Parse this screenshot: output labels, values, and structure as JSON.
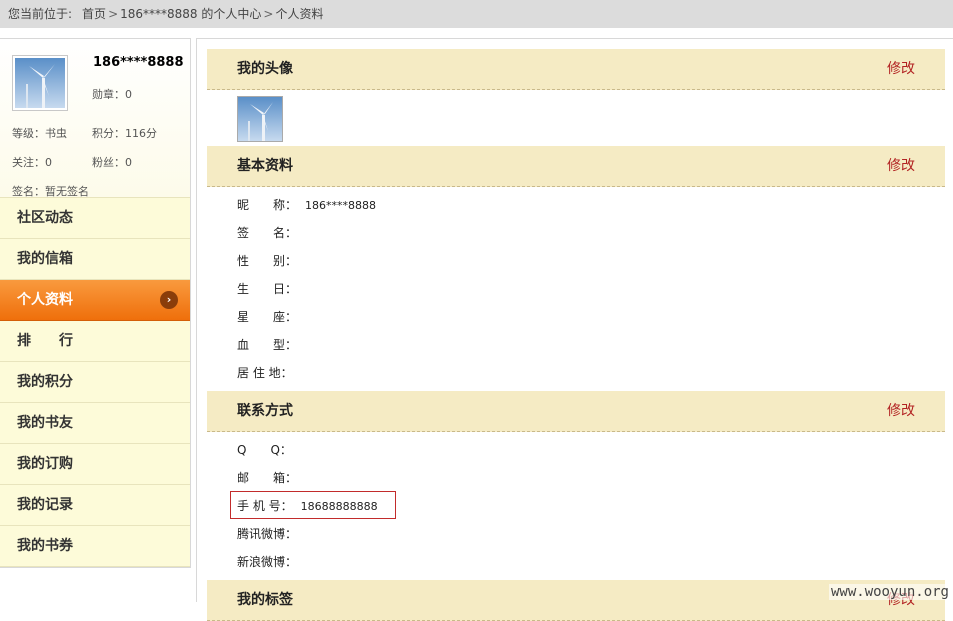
{
  "breadcrumb": {
    "prefix": "您当前位于:",
    "items": [
      "首页",
      "186****8888 的个人中心",
      "个人资料"
    ],
    "sep": ">"
  },
  "profile": {
    "name": "186****8888",
    "medal": "勋章：0",
    "stats": [
      "等级：书虫",
      "积分：116分",
      "关注：0",
      "粉丝：0",
      "签名：暂无签名"
    ]
  },
  "nav": {
    "items": [
      "社区动态",
      "我的信箱",
      "个人资料",
      "排　　行",
      "我的积分",
      "我的书友",
      "我的订购",
      "我的记录",
      "我的书券"
    ],
    "active_arrow": "›"
  },
  "sections": {
    "avatar": {
      "title": "我的头像",
      "edit": "修改"
    },
    "basic": {
      "title": "基本资料",
      "edit": "修改",
      "fields": [
        {
          "label": "昵　　称：",
          "value": "186****8888"
        },
        {
          "label": "签　　名：",
          "value": ""
        },
        {
          "label": "性　　别：",
          "value": ""
        },
        {
          "label": "生　　日：",
          "value": ""
        },
        {
          "label": "星　　座：",
          "value": ""
        },
        {
          "label": "血　　型：",
          "value": ""
        },
        {
          "label": "居 住 地：",
          "value": ""
        }
      ]
    },
    "contact": {
      "title": "联系方式",
      "edit": "修改",
      "fields": [
        {
          "label": "Q　　Q：",
          "value": ""
        },
        {
          "label": "邮　　箱：",
          "value": ""
        },
        {
          "label": "手 机 号：",
          "value": "18688888888"
        },
        {
          "label": "腾讯微博：",
          "value": ""
        },
        {
          "label": "新浪微博：",
          "value": ""
        }
      ]
    },
    "tags": {
      "title": "我的标签",
      "edit": "修改"
    }
  },
  "watermark": "www.wooyun.org",
  "colors": {
    "accent": "#ef6f0b",
    "edit": "#b22222",
    "section_bg": "#f5ebc4"
  }
}
